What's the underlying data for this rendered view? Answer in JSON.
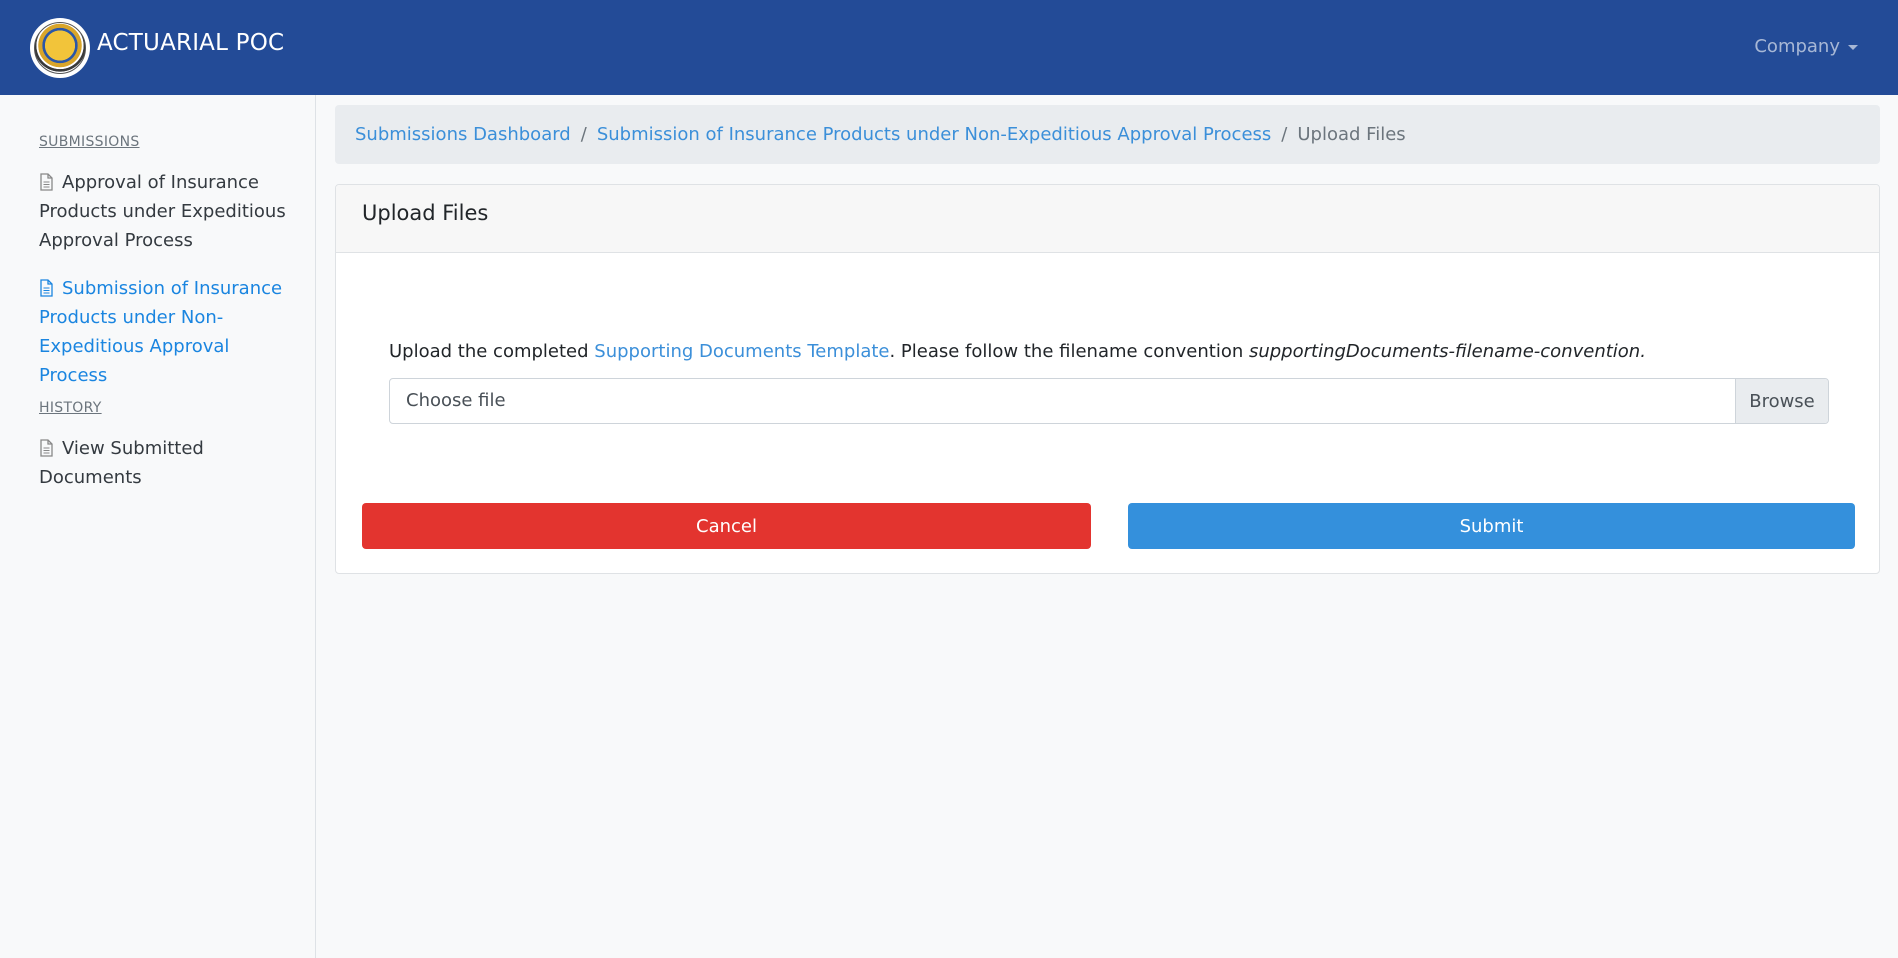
{
  "header": {
    "brand": "ACTUARIAL POC",
    "company_menu": "Company",
    "logo_icon": "insurance-commission-seal"
  },
  "sidebar": {
    "sections": [
      {
        "heading": "SUBMISSIONS",
        "items": [
          {
            "label": "Approval of Insurance Products under Expeditious Approval Process",
            "icon": "document-icon",
            "active": false
          },
          {
            "label": "Submission of Insurance Products under Non-Expeditious Approval Process",
            "icon": "document-icon",
            "active": true
          }
        ]
      },
      {
        "heading": "HISTORY",
        "items": [
          {
            "label": "View Submitted Documents",
            "icon": "document-icon",
            "active": false
          }
        ]
      }
    ]
  },
  "breadcrumb": {
    "items": [
      {
        "label": "Submissions Dashboard",
        "link": true
      },
      {
        "label": "Submission of Insurance Products under Non-Expeditious Approval Process",
        "link": true
      },
      {
        "label": "Upload Files",
        "link": false
      }
    ],
    "separator": "/"
  },
  "card": {
    "title": "Upload Files",
    "instructions": {
      "prefix": "Upload the completed ",
      "template_link": "Supporting Documents Template",
      "middle": ". Please follow the filename convention ",
      "convention": "supportingDocuments-filename-convention."
    },
    "file_input": {
      "placeholder": "Choose file",
      "browse_label": "Browse"
    },
    "cancel_label": "Cancel",
    "submit_label": "Submit"
  },
  "colors": {
    "navbar": "#234b97",
    "link": "#3b8fd9",
    "active_nav": "#1a85e0",
    "cancel": "#e3342f",
    "submit": "#3490dc"
  }
}
